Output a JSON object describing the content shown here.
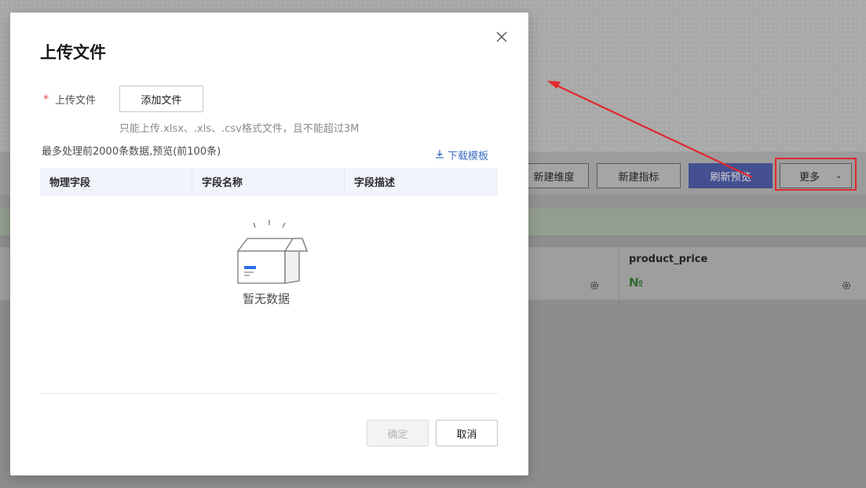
{
  "background": {
    "toolbar": {
      "new_dimension": "新建维度",
      "new_metric": "新建指标",
      "refresh_preview": "刷新预览",
      "more": "更多"
    },
    "field": {
      "name": "product_price",
      "type_symbol": "№"
    }
  },
  "dialog": {
    "title": "上传文件",
    "upload_label": "上传文件",
    "required_mark": "*",
    "add_file_button": "添加文件",
    "hint": "只能上传.xlsx、.xls、.csv格式文件，且不能超过3M",
    "max_info": "最多处理前2000条数据,预览(前100条)",
    "download_template": "下载模板",
    "table_headers": [
      "物理字段",
      "字段名称",
      "字段描述"
    ],
    "empty_text": "暂无数据",
    "confirm_button": "确定",
    "cancel_button": "取消"
  },
  "colors": {
    "accent": "#3d6fc4",
    "primary_button": "#5b6fd6",
    "annotation_red": "#e0282e",
    "required": "#e34d4d"
  }
}
